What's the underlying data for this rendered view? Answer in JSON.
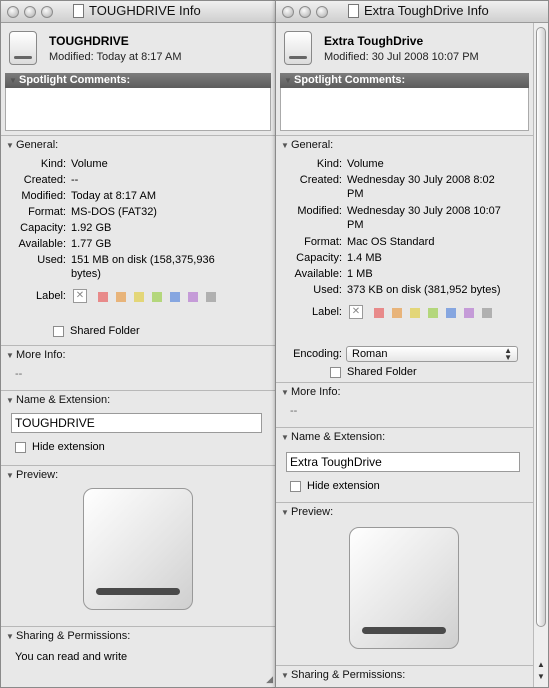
{
  "left": {
    "title": "TOUGHDRIVE Info",
    "name": "TOUGHDRIVE",
    "modified_header": "Modified: Today at 8:17 AM",
    "spotlight_label": "Spotlight Comments:",
    "general_label": "General:",
    "fields": [
      {
        "label": "Kind:",
        "value": "Volume"
      },
      {
        "label": "Created:",
        "value": "--"
      },
      {
        "label": "Modified:",
        "value": "Today at 8:17 AM"
      },
      {
        "label": "Format:",
        "value": "MS-DOS (FAT32)"
      },
      {
        "label": "Capacity:",
        "value": "1.92 GB"
      },
      {
        "label": "Available:",
        "value": "1.77 GB"
      },
      {
        "label": "Used:",
        "value": "151 MB on disk (158,375,936",
        "value2": "bytes)"
      }
    ],
    "label_label": "Label:",
    "shared_folder": "Shared Folder",
    "more_info_label": "More Info:",
    "more_info_value": "--",
    "name_ext_label": "Name & Extension:",
    "name_value": "TOUGHDRIVE",
    "hide_extension": "Hide extension",
    "preview_label": "Preview:",
    "sharing_label": "Sharing & Permissions:",
    "sharing_value": "You can read and write"
  },
  "right": {
    "title": "Extra ToughDrive Info",
    "name": "Extra ToughDrive",
    "modified_header": "Modified: 30 Jul 2008 10:07 PM",
    "spotlight_label": "Spotlight Comments:",
    "general_label": "General:",
    "fields": [
      {
        "label": "Kind:",
        "value": "Volume"
      },
      {
        "label": "Created:",
        "value": "Wednesday 30 July 2008 8:02",
        "value2": "PM"
      },
      {
        "label": "Modified:",
        "value": "Wednesday 30 July 2008 10:07",
        "value2": "PM"
      },
      {
        "label": "Format:",
        "value": "Mac OS Standard"
      },
      {
        "label": "Capacity:",
        "value": "1.4 MB"
      },
      {
        "label": "Available:",
        "value": "1 MB"
      },
      {
        "label": "Used:",
        "value": "373 KB on disk (381,952 bytes)"
      }
    ],
    "label_label": "Label:",
    "encoding_label": "Encoding:",
    "encoding_value": "Roman",
    "shared_folder": "Shared Folder",
    "more_info_label": "More Info:",
    "more_info_value": "--",
    "name_ext_label": "Name & Extension:",
    "name_value": "Extra ToughDrive",
    "hide_extension": "Hide extension",
    "preview_label": "Preview:",
    "sharing_label": "Sharing & Permissions:"
  },
  "label_colors": [
    "#e88a8a",
    "#e8b47a",
    "#e3d678",
    "#b4d77c",
    "#86a6e0",
    "#c59bd8",
    "#b0b0b0"
  ],
  "icons": [
    "close-light-icon",
    "minimize-light-icon",
    "zoom-light-icon",
    "document-icon",
    "drive-icon",
    "disclosure-triangle-icon",
    "checkbox-icon",
    "popup-arrows-icon",
    "resize-grip-icon"
  ]
}
